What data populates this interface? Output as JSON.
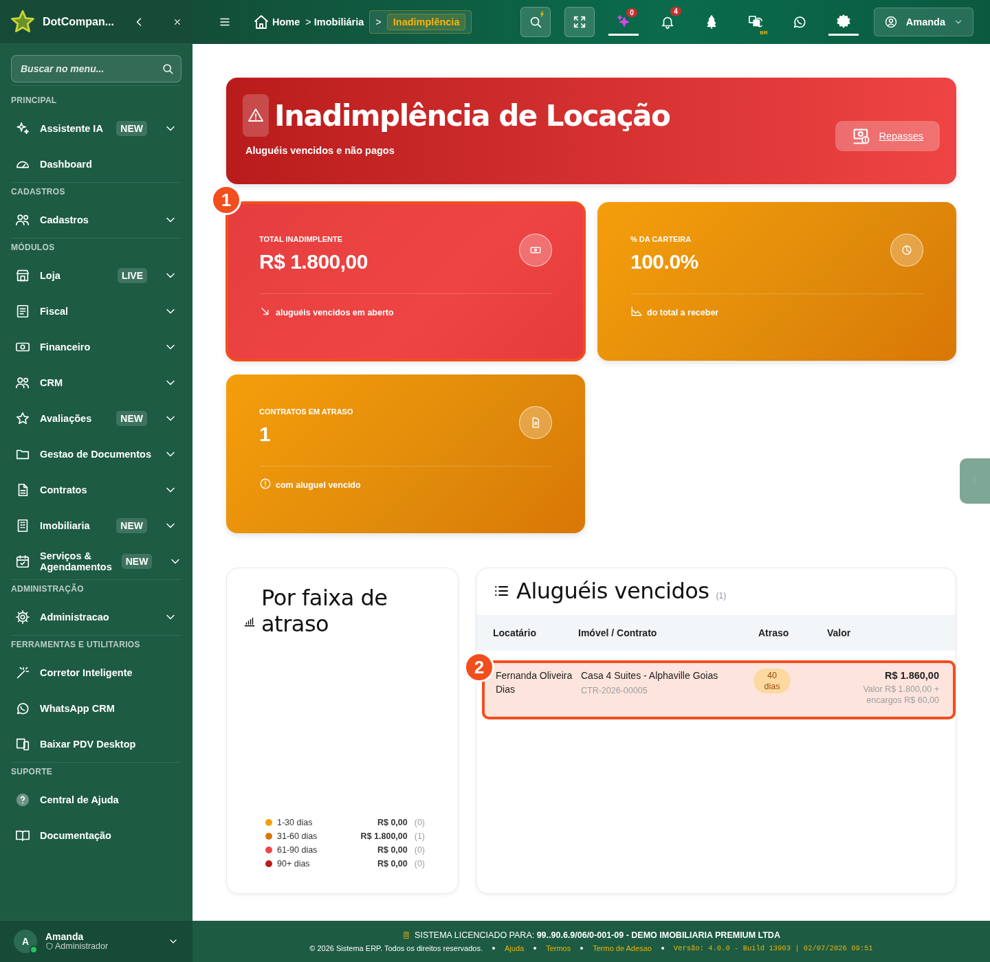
{
  "sidebar": {
    "brand": "DotCompan...",
    "search": {
      "placeholder": "Buscar no menu..."
    },
    "sections": [
      {
        "title": "PRINCIPAL",
        "items": [
          {
            "label": "Assistente IA",
            "badge": "NEW",
            "expandable": true
          },
          {
            "label": "Dashboard",
            "expandable": false
          }
        ]
      },
      {
        "title": "CADASTROS",
        "items": [
          {
            "label": "Cadastros",
            "expandable": true
          }
        ]
      },
      {
        "title": "MÓDULOS",
        "items": [
          {
            "label": "Loja",
            "badge": "LIVE",
            "expandable": true
          },
          {
            "label": "Fiscal",
            "expandable": true
          },
          {
            "label": "Financeiro",
            "expandable": true
          },
          {
            "label": "CRM",
            "expandable": true
          },
          {
            "label": "Avaliações",
            "badge": "NEW",
            "expandable": true
          },
          {
            "label": "Gestao de Documentos",
            "expandable": true
          },
          {
            "label": "Contratos",
            "expandable": true
          },
          {
            "label": "Imobiliaria",
            "badge": "NEW",
            "expandable": true
          },
          {
            "label": "Serviços & Agendamentos",
            "badge": "NEW",
            "expandable": true
          }
        ]
      },
      {
        "title": "ADMINISTRAÇÃO",
        "items": [
          {
            "label": "Administracao",
            "expandable": true
          }
        ]
      },
      {
        "title": "FERRAMENTAS E UTILITARIOS",
        "items": [
          {
            "label": "Corretor Inteligente",
            "expandable": false
          },
          {
            "label": "WhatsApp CRM",
            "expandable": false
          },
          {
            "label": "Baixar PDV Desktop",
            "expandable": false
          }
        ]
      },
      {
        "title": "SUPORTE",
        "items": [
          {
            "label": "Central de Ajuda",
            "expandable": false
          },
          {
            "label": "Documentação",
            "expandable": false
          }
        ]
      }
    ],
    "user": {
      "initial": "A",
      "name": "Amanda",
      "role": "Administrador"
    }
  },
  "topbar": {
    "breadcrumbs": [
      {
        "label": "Home",
        "selected": false
      },
      {
        "prefix": ">",
        "label": "Imobiliária",
        "selected": false
      },
      {
        "prefix": ">",
        "label": "Inadimplência",
        "selected": true
      }
    ],
    "actions": [
      {
        "kind": "search",
        "active": false
      },
      {
        "kind": "fullscreen",
        "active": false
      },
      {
        "kind": "assistant",
        "badge": "0",
        "active": true
      },
      {
        "kind": "notifications",
        "badge": "4",
        "active": false
      },
      {
        "kind": "tree",
        "active": false
      },
      {
        "kind": "translate",
        "caption": "BR",
        "active": false
      },
      {
        "kind": "whatsapp",
        "active": false
      },
      {
        "kind": "settings",
        "active": true
      }
    ],
    "user": "Amanda"
  },
  "hero": {
    "title": "Inadimplência de Locação",
    "subtitle": "Aluguéis vencidos e não pagos",
    "action": "Repasses"
  },
  "stats": [
    {
      "kind": "danger",
      "label": "TOTAL INADIMPLENTE",
      "value": "R$ 1.800,00",
      "note": "aluguéis vencidos em aberto",
      "highlighted": true,
      "marker": "1"
    },
    {
      "kind": "warning",
      "label": "% DA CARTEIRA",
      "value": "100.0%",
      "note": "do total a receber",
      "highlighted": false
    },
    {
      "kind": "warning",
      "label": "CONTRATOS EM ATRASO",
      "value": "1",
      "note": "com aluguel vencido",
      "highlighted": false
    }
  ],
  "aging": {
    "title": "Por faixa de atraso",
    "legend": [
      {
        "label": "1-30 dias",
        "color": "#f59e0b",
        "value": "R$ 0,00",
        "count": "(0)"
      },
      {
        "label": "31-60 dias",
        "color": "#d97706",
        "value": "R$ 1.800,00",
        "count": "(1)"
      },
      {
        "label": "61-90 dias",
        "color": "#ef4444",
        "value": "R$ 0,00",
        "count": "(0)"
      },
      {
        "label": "90+ dias",
        "color": "#b91c1c",
        "value": "R$ 0,00",
        "count": "(0)"
      }
    ]
  },
  "overdue": {
    "title": "Aluguéis vencidos",
    "count": "(1)",
    "columns": [
      "Locatário",
      "Imóvel / Contrato",
      "Atraso",
      "Valor"
    ],
    "rows": [
      {
        "tenant": "Fernanda Oliveira Dias",
        "property": "Casa 4 Suites - Alphaville Goias",
        "contract": "CTR-2026-00005",
        "delay": "40 dias",
        "total": "R$ 1.860,00",
        "breakdown": "Valor R$ 1.800,00 + encargos R$ 60,00",
        "highlighted": true,
        "marker": "2"
      }
    ]
  },
  "footer": {
    "license": "SISTEMA LICENCIADO PARA: **99..90.6.9/06/0-001-09 - DEMO IMOBILIARIA PREMIUM LTDA**",
    "copyright": "© 2026 Sistema ERP. Todos os direitos reservados.",
    "links": [
      "Ajuda",
      "Termos",
      "Termo de Adesao"
    ],
    "version": "Versão: 4.0.0 - Build 13903 | 02/07/2026 09:51"
  }
}
